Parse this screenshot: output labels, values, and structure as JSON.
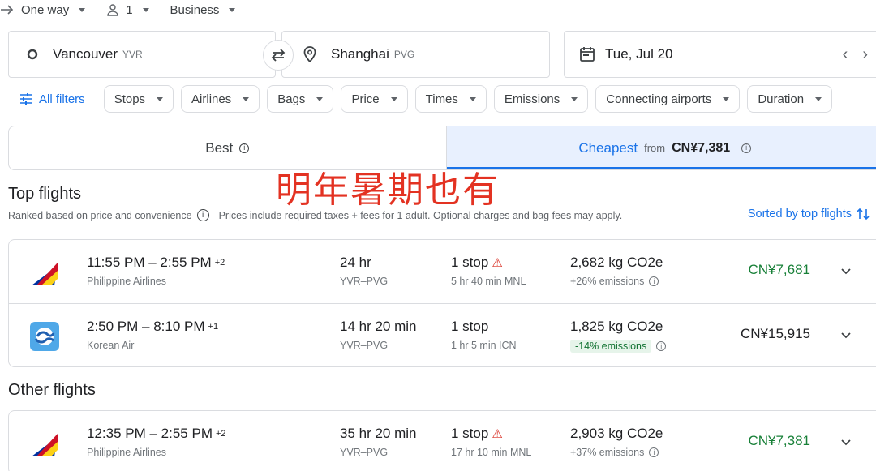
{
  "trip": {
    "type": "One way",
    "passengers": "1",
    "cabin": "Business"
  },
  "search": {
    "origin": "Vancouver",
    "origin_code": "YVR",
    "destination": "Shanghai",
    "destination_code": "PVG",
    "date": "Tue, Jul 20"
  },
  "filters": {
    "all_filters": "All filters",
    "chips": [
      "Stops",
      "Airlines",
      "Bags",
      "Price",
      "Times",
      "Emissions",
      "Connecting airports",
      "Duration"
    ]
  },
  "tabs": {
    "best": "Best",
    "cheapest": "Cheapest",
    "from_label": "from",
    "from_price": "CN¥7,381"
  },
  "overlay_text": "明年暑期也有",
  "top_flights": {
    "heading": "Top flights",
    "note1": "Ranked based on price and convenience",
    "note2": "Prices include required taxes + fees for 1 adult. Optional charges and bag fees may apply.",
    "sorted": "Sorted by top flights",
    "flights": [
      {
        "time": "11:55 PM – 2:55 PM",
        "plus": "+2",
        "airline": "Philippine Airlines",
        "duration": "24 hr",
        "route": "YVR–PVG",
        "stops": "1 stop",
        "layover": "5 hr 40 min MNL",
        "co2": "2,682 kg CO2e",
        "emissions": "+26% emissions",
        "price": "CN¥7,681"
      },
      {
        "time": "2:50 PM – 8:10 PM",
        "plus": "+1",
        "airline": "Korean Air",
        "duration": "14 hr 20 min",
        "route": "YVR–PVG",
        "stops": "1 stop",
        "layover": "1 hr 5 min ICN",
        "co2": "1,825 kg CO2e",
        "emissions": "-14% emissions",
        "price": "CN¥15,915"
      }
    ]
  },
  "other_flights": {
    "heading": "Other flights",
    "flights": [
      {
        "time": "12:35 PM – 2:55 PM",
        "plus": "+2",
        "airline": "Philippine Airlines",
        "duration": "35 hr 20 min",
        "route": "YVR–PVG",
        "stops": "1 stop",
        "layover": "17 hr 10 min MNL",
        "co2": "2,903 kg CO2e",
        "emissions": "+37% emissions",
        "price": "CN¥7,381"
      }
    ]
  },
  "colors": {
    "accent": "#1a73e8",
    "price_green": "#188038",
    "warning": "#d93025",
    "overlay": "#e33222"
  }
}
